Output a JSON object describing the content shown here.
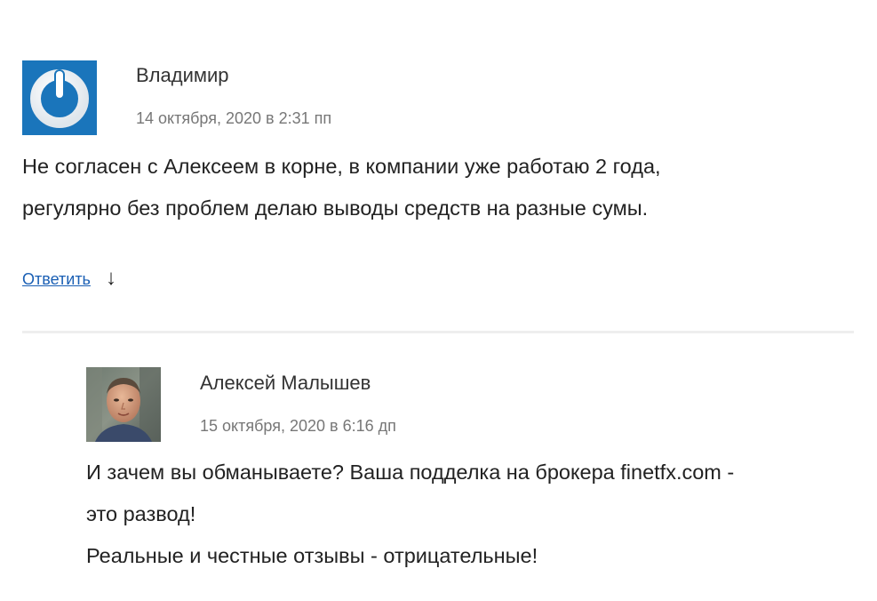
{
  "comments": [
    {
      "author": "Владимир",
      "date": "14 октября, 2020 в 2:31 пп",
      "avatar": "gravatar-power-icon",
      "lines": [
        "Не согласен с Алексеем в корне, в компании уже работаю 2 года,",
        "регулярно без проблем делаю выводы средств на разные сумы."
      ],
      "reply_label": "Ответить",
      "reply_arrow": "↓"
    },
    {
      "author": "Алексей Малышев",
      "date": "15 октября, 2020 в 6:16 дп",
      "avatar": "user-photo",
      "lines": [
        "И зачем вы обманываете? Ваша подделка на брокера finetfx.com -",
        "это развод!",
        "Реальные и честные отзывы - отрицательные!"
      ]
    }
  ],
  "colors": {
    "gravatar_bg": "#1a75bb",
    "link": "#1a5fb4",
    "meta": "#777777",
    "text": "#222222"
  }
}
